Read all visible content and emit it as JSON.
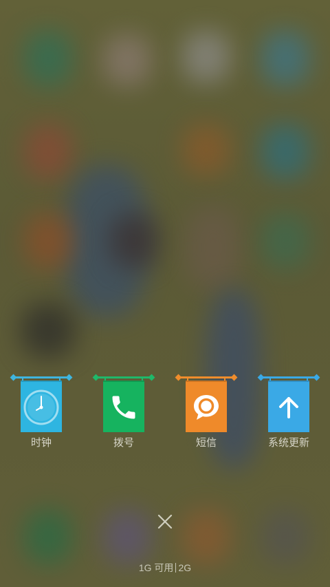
{
  "recent_apps": [
    {
      "label": "时钟",
      "icon": "clock-icon",
      "color": "#2eb5e1",
      "rod_color": "#3fb5df"
    },
    {
      "label": "拨号",
      "icon": "phone-icon",
      "color": "#16b35f",
      "rod_color": "#1fb86a"
    },
    {
      "label": "短信",
      "icon": "message-icon",
      "color": "#ef8a2a",
      "rod_color": "#f08d2c"
    },
    {
      "label": "系统更新",
      "icon": "arrow-up-icon",
      "color": "#3aa9e6",
      "rod_color": "#3aa9e6"
    }
  ],
  "close_icon": "close-icon",
  "memory": {
    "available": "1G 可用",
    "total": "2G"
  }
}
